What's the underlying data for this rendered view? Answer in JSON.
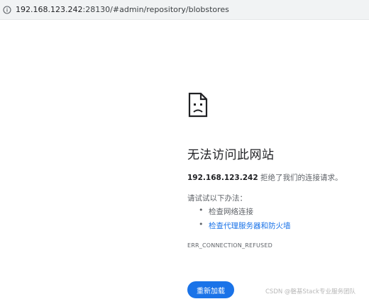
{
  "address_bar": {
    "info_icon": "info-icon",
    "url_host": "192.168.123.242",
    "url_rest": ":28130/#admin/repository/blobstores"
  },
  "error_page": {
    "icon": "sad-document-icon",
    "title": "无法访问此网站",
    "host": "192.168.123.242",
    "description_suffix": " 拒绝了我们的连接请求。",
    "suggest_heading": "请试试以下办法：",
    "suggestions": [
      {
        "label": "检查网络连接",
        "is_link": false
      },
      {
        "label": "检查代理服务器和防火墙",
        "is_link": true
      }
    ],
    "error_code": "ERR_CONNECTION_REFUSED",
    "reload_label": "重新加载"
  },
  "watermark": "CSDN @磐基Stack专业服务团队",
  "colors": {
    "accent": "#1a73e8",
    "text_primary": "#202124",
    "text_secondary": "#5f6368",
    "address_bar_bg": "#f1f3f4"
  }
}
